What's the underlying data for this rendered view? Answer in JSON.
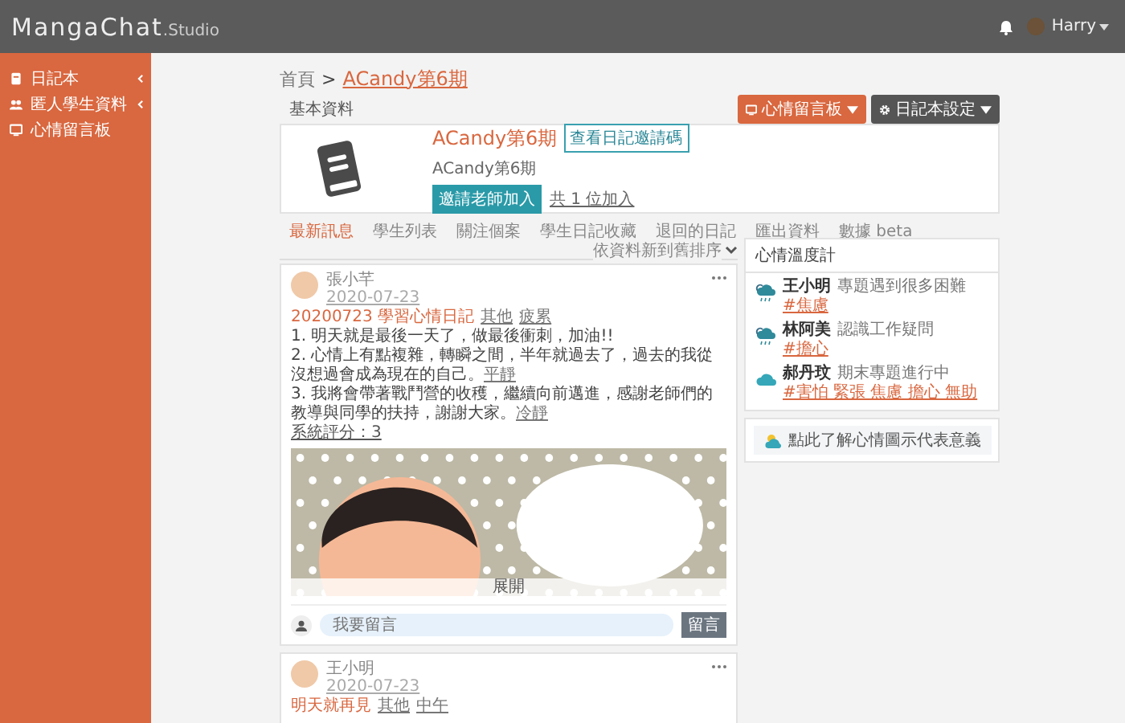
{
  "brand": {
    "name": "MangaChat",
    "suffix": ".Studio"
  },
  "topbar": {
    "user": "Harry"
  },
  "sidebar": {
    "items": [
      {
        "label": "日記本",
        "has_submenu": true
      },
      {
        "label": "匿人學生資料",
        "has_submenu": true
      },
      {
        "label": "心情留言板",
        "has_submenu": false
      }
    ]
  },
  "breadcrumb": {
    "items": [
      "首頁",
      "ACandy第6期"
    ],
    "separator": ">"
  },
  "section_title": "基本資料",
  "header_buttons": [
    {
      "label": "心情留言板",
      "kind": "primary"
    },
    {
      "label": "日記本設定",
      "kind": "dark"
    }
  ],
  "profile": {
    "title": "ACandy第6期",
    "code_button": "查看日記邀請碼",
    "subtitle": "ACandy第6期",
    "invite_button": "邀請老師加入",
    "joined_link": "共 1 位加入"
  },
  "tabs": [
    {
      "label": "最新訊息",
      "selected": true
    },
    {
      "label": "學生列表",
      "selected": false
    },
    {
      "label": "關注個案",
      "selected": false
    },
    {
      "label": "學生日記收藏",
      "selected": false
    },
    {
      "label": "退回的日記",
      "selected": false
    },
    {
      "label": "匯出資料",
      "selected": false
    },
    {
      "label": "數據 beta",
      "selected": false
    }
  ],
  "sort_label": "依資料新到舊排序",
  "posts": [
    {
      "author": "張小芊",
      "date": "2020-07-23",
      "title": "20200723 學習心情日記",
      "tags": [
        "其他",
        "疲累"
      ],
      "lines": [
        {
          "text": "1. 明天就是最後一天了，做最後衝刺，加油!!"
        },
        {
          "text": "2. 心情上有點複雜，轉瞬之間，半年就過去了，過去的我從沒想過會成為現在的自己。",
          "tag": "平靜"
        },
        {
          "text": "3. 我將會帶著戰鬥營的收穫，繼續向前邁進，感謝老師們的教導與同學的扶持，謝謝大家。",
          "tag": "冷靜"
        }
      ],
      "rating": "系統評分：3",
      "image": {
        "caption": "展開"
      },
      "comment": {
        "placeholder": "我要留言",
        "button": "留言"
      }
    },
    {
      "author": "王小明",
      "date": "2020-07-23",
      "title": "明天就再見",
      "tags": [
        "其他",
        "中午"
      ]
    }
  ],
  "mood": {
    "title": "心情溫度計",
    "entries": [
      {
        "name": "王小明",
        "note": "專題遇到很多困難",
        "tags": "#焦慮",
        "kind": "rain"
      },
      {
        "name": "林阿美",
        "note": "認識工作疑問",
        "tags": "#擔心",
        "kind": "rain"
      },
      {
        "name": "郝丹玟",
        "note": "期末專題進行中",
        "tags": "#害怕 緊張 焦慮 擔心 無助",
        "kind": "cloud"
      }
    ],
    "legend_button": "點此了解心情圖示代表意義"
  }
}
